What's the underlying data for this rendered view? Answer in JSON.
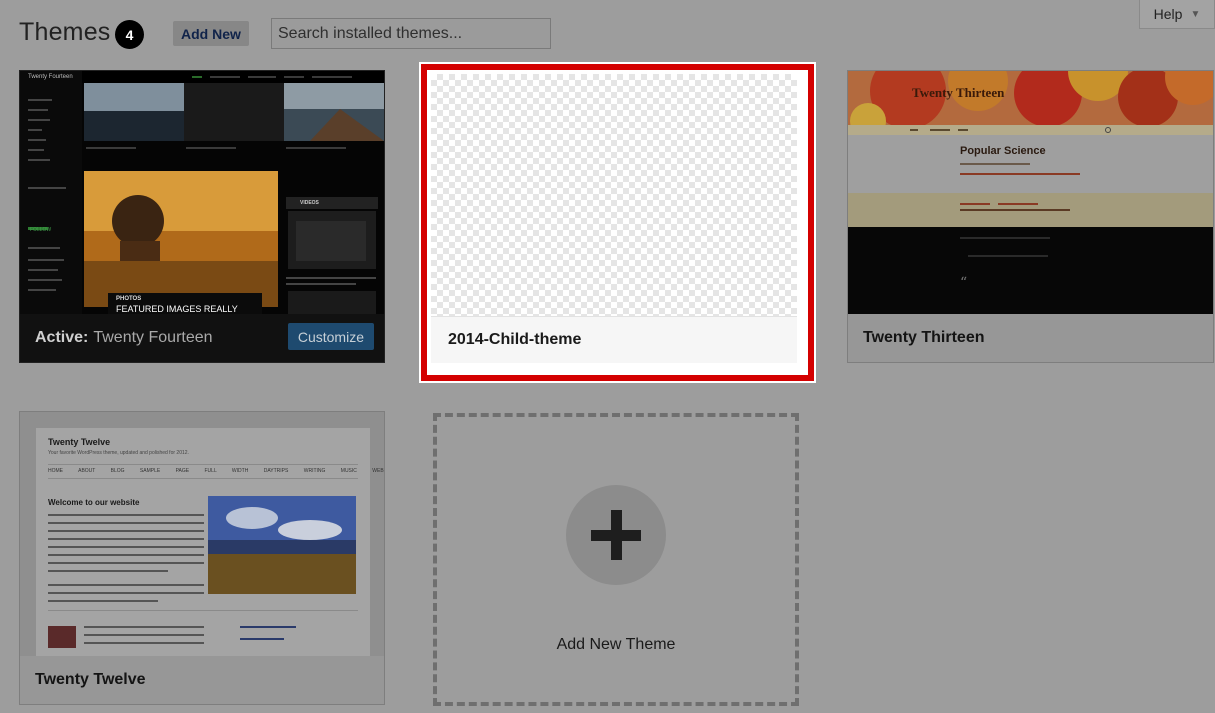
{
  "header": {
    "title": "Themes",
    "count": "4",
    "add_new_label": "Add New",
    "search_placeholder": "Search installed themes...",
    "help_label": "Help"
  },
  "themes": [
    {
      "name": "Twenty Fourteen",
      "active": true,
      "active_prefix": "Active:",
      "customize_label": "Customize",
      "preview": {
        "site_title": "Twenty Fourteen",
        "post_category": "PHOTOS",
        "post_title": "FEATURED IMAGES REALLY",
        "video_label": "VIDEOS",
        "follow_label": "FOLLOW"
      }
    },
    {
      "name": "2014-Child-theme",
      "active": false
    },
    {
      "name": "Twenty Thirteen",
      "active": false,
      "preview": {
        "site_title": "Twenty Thirteen",
        "post_title": "Popular Science"
      }
    },
    {
      "name": "Twenty Twelve",
      "active": false,
      "preview": {
        "site_title": "Twenty Twelve",
        "tagline": "Your favorite WordPress theme, updated and polished for 2012.",
        "post_title": "Welcome to our website",
        "menu": [
          "HOME",
          "ABOUT",
          "BLOG",
          "SAMPLE PAGE",
          "FULL WIDTH",
          "DAYTRIPS",
          "WRITING",
          "MUSIC",
          "WEB"
        ]
      }
    }
  ],
  "add_new_theme_label": "Add New Theme",
  "colors": {
    "highlight_border": "#d40000",
    "customize_button": "#1e4a6f"
  }
}
